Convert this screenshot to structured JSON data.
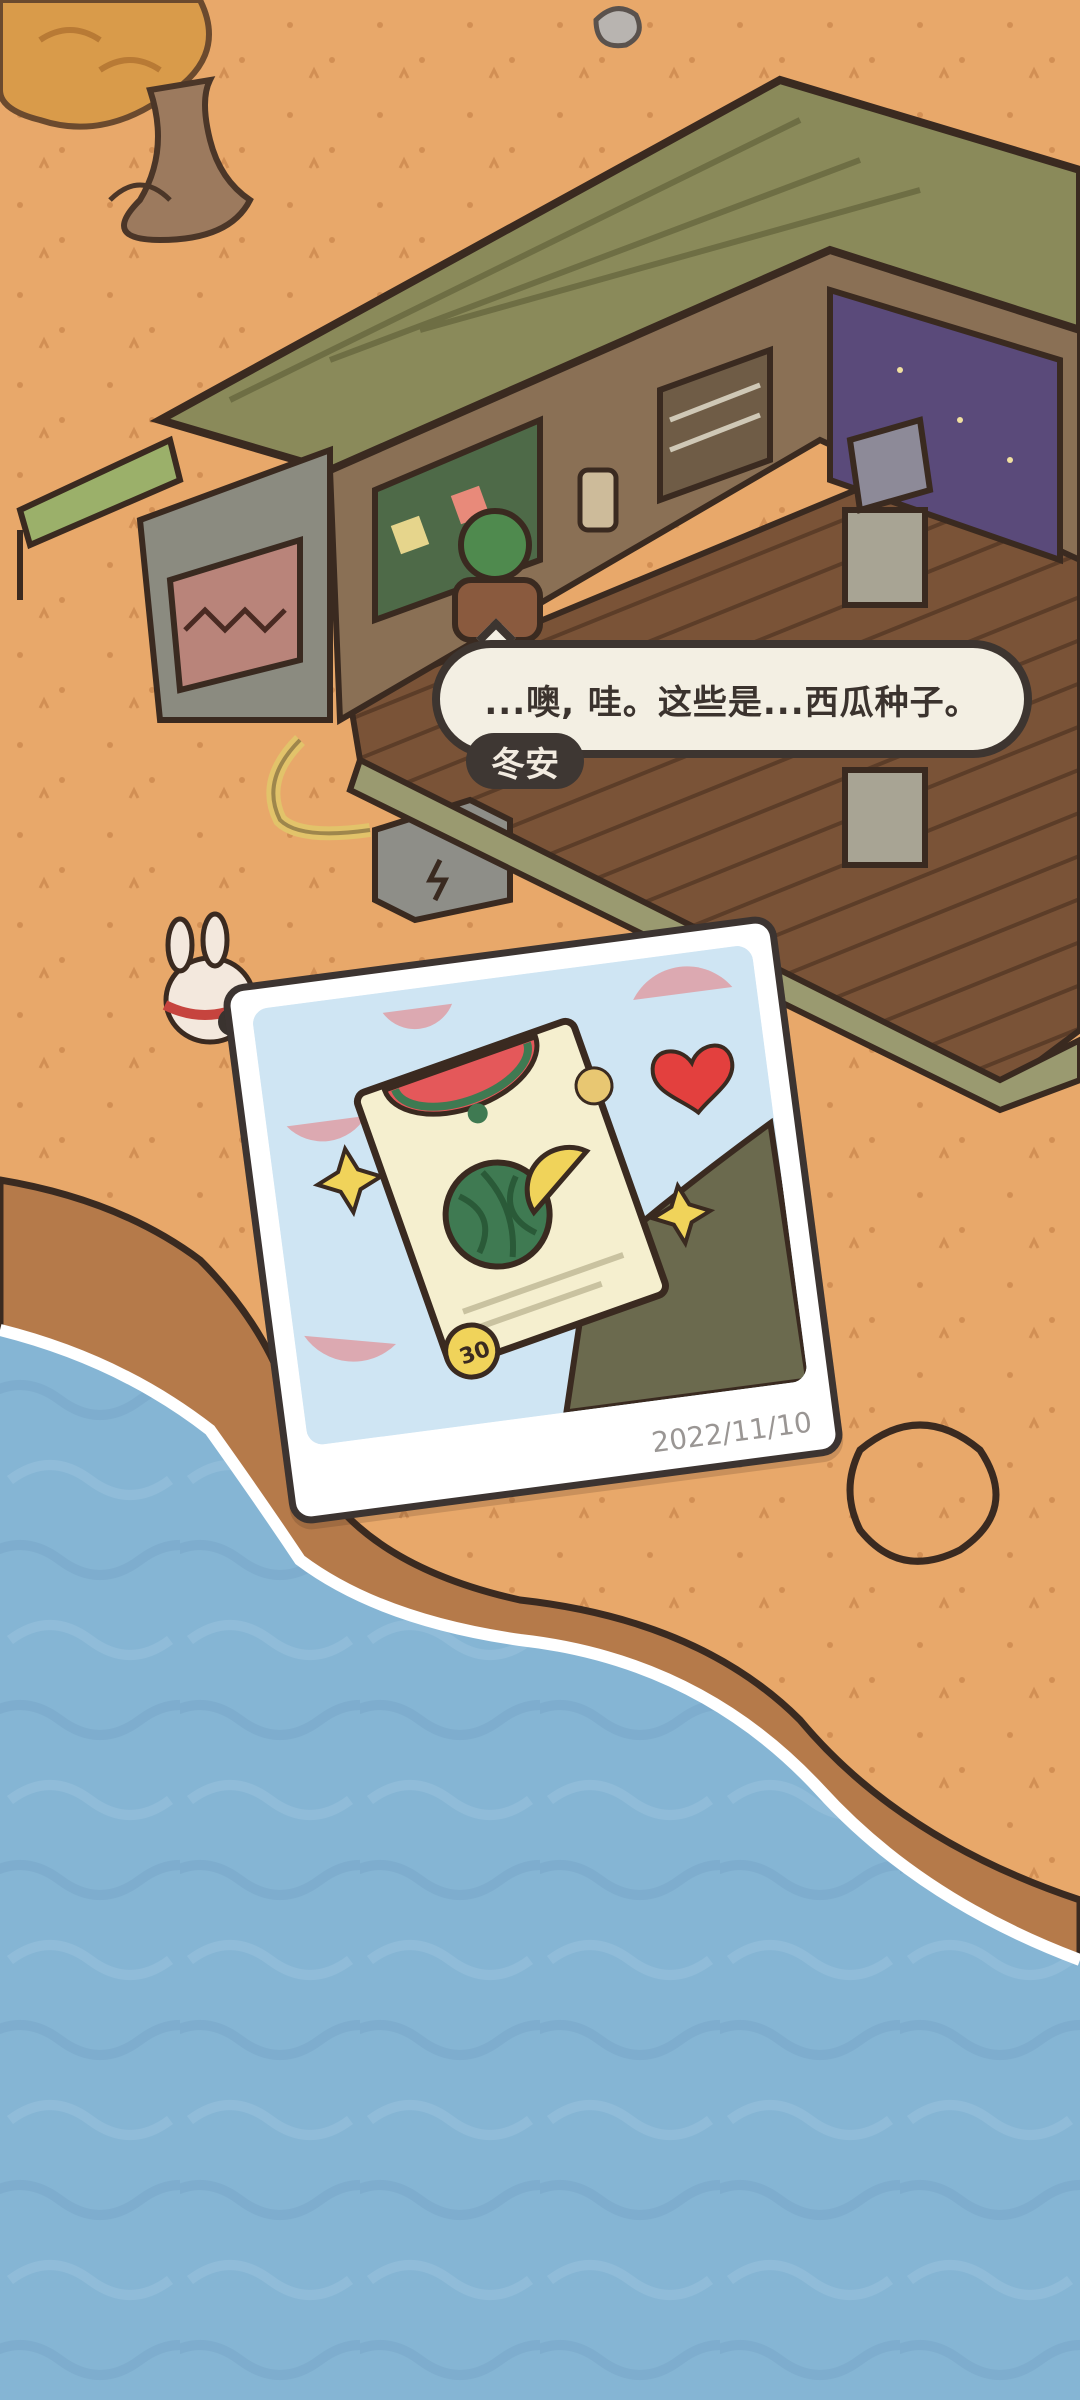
{
  "dialogue": {
    "text": "...噢, 哇。这些是...西瓜种子。",
    "speaker": "冬安"
  },
  "photo": {
    "date": "2022/11/10",
    "price_badge": "30"
  },
  "colors": {
    "sand": "#e8a86a",
    "water": "#7fb2d3",
    "outline": "#3d3530",
    "bubble": "#f3efe3",
    "watermelon_green": "#3f7a52",
    "watermelon_red": "#e45a5e"
  },
  "icons": {
    "heart": "heart-icon",
    "sparkle": "sparkle-icon",
    "thumbs_up": "thumbs-up-icon"
  }
}
